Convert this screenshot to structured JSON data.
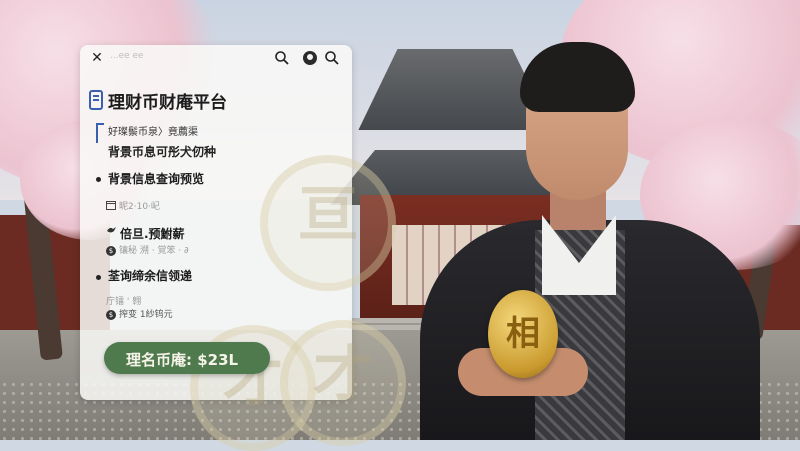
{
  "panel": {
    "faded_url": "...ee ee",
    "title": "理财币财庵平台",
    "subheading_small": "好璨鬃币泉〉竟薦渠",
    "subheading": "背景币息可彤犬仞种",
    "sections": [
      {
        "title": "背景信息查询预览",
        "meta": "昵2·10·屺",
        "meta_icon": "calendar-icon"
      },
      {
        "title": "倍旦.预鮒薪",
        "meta": "镶秘 溯 · 覚笨 · ∂",
        "meta_icon": "dollar-icon",
        "prefix_icon": "bird-icon"
      },
      {
        "title": "荃询缔余信领递",
        "meta_line1": "庁镭 ' 翱",
        "meta_line2": "搾变  1紗钨元",
        "meta_icon": "dollar-icon"
      }
    ],
    "price_button_label": "理名币庵: $23L",
    "price_button_color": "#4f7a4e"
  },
  "hero_coin_glyph": "相",
  "ghost_coin_glyphs": [
    "亘",
    "才",
    "才"
  ],
  "icons": {
    "close": "close-icon",
    "search": "search-icon",
    "avatar": "avatar-icon",
    "search_secondary": "search-icon"
  },
  "colors": {
    "accent_green": "#4f7a4e",
    "logo_blue": "#3a5fb0"
  }
}
